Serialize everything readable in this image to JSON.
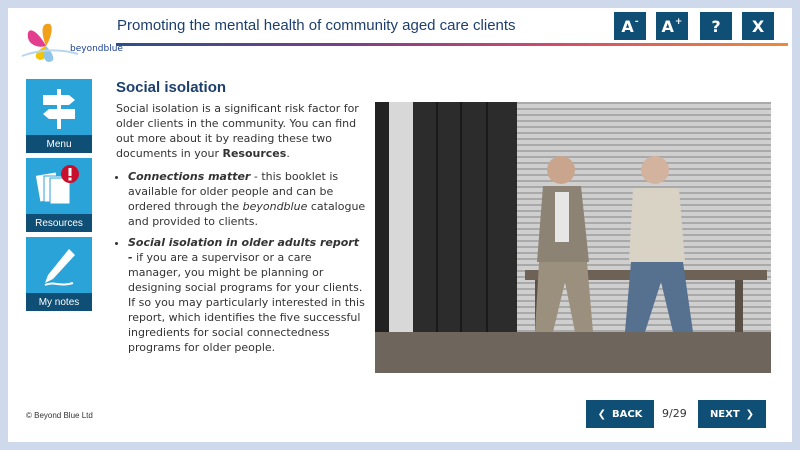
{
  "header": {
    "logo_text": "beyondblue",
    "title": "Promoting the mental health of community aged care clients",
    "buttons": {
      "decrease_font": "A",
      "decrease_font_sign": "-",
      "increase_font": "A",
      "increase_font_sign": "+",
      "help": "?",
      "close": "X"
    }
  },
  "sidebar": {
    "items": [
      {
        "label": "Menu",
        "icon": "signpost-icon"
      },
      {
        "label": "Resources",
        "icon": "documents-alert-icon"
      },
      {
        "label": "My notes",
        "icon": "pen-icon"
      }
    ]
  },
  "content": {
    "heading": "Social isolation",
    "intro_plain": "Social isolation is a significant risk factor for older clients in the community. You can find out more about it by reading these two documents in your ",
    "intro_bold": "Resources",
    "intro_end": ".",
    "bullets": [
      {
        "title": "Connections matter",
        "text_a": " - this booklet is available for older people and can be ordered through the ",
        "italic": "beyondblue",
        "text_b": " catalogue and provided to clients."
      },
      {
        "title": "Social isolation in older adults report -",
        "text_a": " if you are a supervisor or a care manager, you might be planning or designing social programs for your clients. If so you may particularly interested in this report, which identifies the five successful ingredients for social connectedness programs for older people."
      }
    ],
    "photo_icon": "photo-two-elderly-men-on-bench"
  },
  "footer": {
    "copyright": "© Beyond Blue Ltd",
    "back_label": "BACK",
    "next_label": "NEXT",
    "page_count": "9/29"
  },
  "colors": {
    "button_dark": "#0f4e75",
    "nav_light": "#2aa3d8",
    "title_text": "#1d3f6e",
    "page_bg": "#cfd9ec"
  }
}
